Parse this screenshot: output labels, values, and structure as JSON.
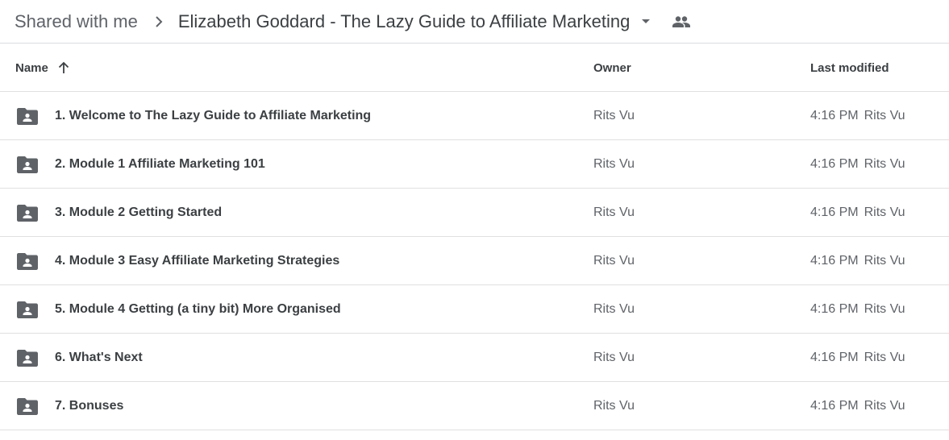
{
  "breadcrumb": {
    "root": "Shared with me",
    "current": "Elizabeth Goddard - The Lazy Guide to Affiliate Marketing",
    "separator_icon": "chevron-right-icon",
    "dropdown_icon": "caret-down-icon",
    "shared_icon": "people-icon"
  },
  "columns": {
    "name": "Name",
    "owner": "Owner",
    "last_modified": "Last modified",
    "sort_icon": "arrow-up-icon"
  },
  "files": [
    {
      "name": "1. Welcome to The Lazy Guide to Affiliate Marketing",
      "owner": "Rits Vu",
      "modified_time": "4:16 PM",
      "modified_by": "Rits Vu",
      "icon": "shared-folder-icon"
    },
    {
      "name": "2. Module 1 Affiliate Marketing 101",
      "owner": "Rits Vu",
      "modified_time": "4:16 PM",
      "modified_by": "Rits Vu",
      "icon": "shared-folder-icon"
    },
    {
      "name": "3. Module 2 Getting Started",
      "owner": "Rits Vu",
      "modified_time": "4:16 PM",
      "modified_by": "Rits Vu",
      "icon": "shared-folder-icon"
    },
    {
      "name": "4. Module 3 Easy Affiliate Marketing Strategies",
      "owner": "Rits Vu",
      "modified_time": "4:16 PM",
      "modified_by": "Rits Vu",
      "icon": "shared-folder-icon"
    },
    {
      "name": "5. Module 4 Getting (a tiny bit) More Organised",
      "owner": "Rits Vu",
      "modified_time": "4:16 PM",
      "modified_by": "Rits Vu",
      "icon": "shared-folder-icon"
    },
    {
      "name": "6. What's Next",
      "owner": "Rits Vu",
      "modified_time": "4:16 PM",
      "modified_by": "Rits Vu",
      "icon": "shared-folder-icon"
    },
    {
      "name": "7. Bonuses",
      "owner": "Rits Vu",
      "modified_time": "4:16 PM",
      "modified_by": "Rits Vu",
      "icon": "shared-folder-icon"
    }
  ]
}
